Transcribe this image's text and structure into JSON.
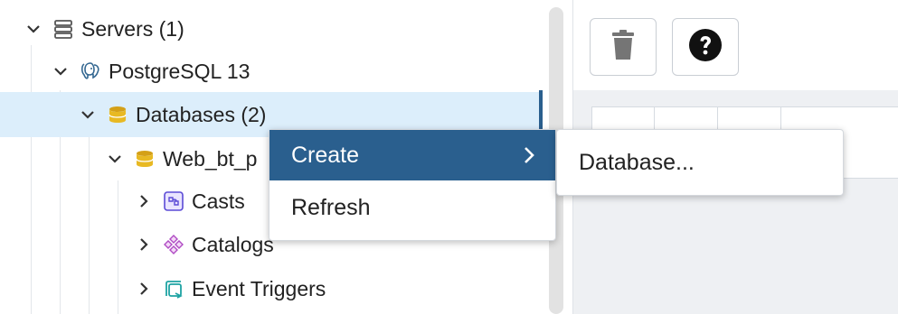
{
  "tree": {
    "items": [
      {
        "label": "Servers (1)",
        "icon": "servers-icon",
        "expanded": true
      },
      {
        "label": "PostgreSQL 13",
        "icon": "postgresql-elephant-icon",
        "expanded": true
      },
      {
        "label": "Databases (2)",
        "icon": "databases-icon",
        "expanded": true,
        "selected": true
      },
      {
        "label": "Web_bt_p",
        "icon": "database-icon",
        "expanded": true
      },
      {
        "label": "Casts",
        "icon": "casts-icon",
        "expanded": false
      },
      {
        "label": "Catalogs",
        "icon": "catalogs-icon",
        "expanded": false
      },
      {
        "label": "Event Triggers",
        "icon": "event-triggers-icon",
        "expanded": false
      }
    ]
  },
  "toolbar": {
    "delete_icon": "trash-icon",
    "help_icon": "help-icon"
  },
  "context_menu": {
    "items": [
      {
        "label": "Create",
        "has_submenu": true,
        "active": true
      },
      {
        "label": "Refresh",
        "has_submenu": false,
        "active": false
      }
    ],
    "submenu": {
      "items": [
        {
          "label": "Database..."
        }
      ]
    }
  },
  "colors": {
    "accent": "#2a5f8e",
    "selected_row": "#dceefb",
    "database_icon": "#d4a017"
  }
}
